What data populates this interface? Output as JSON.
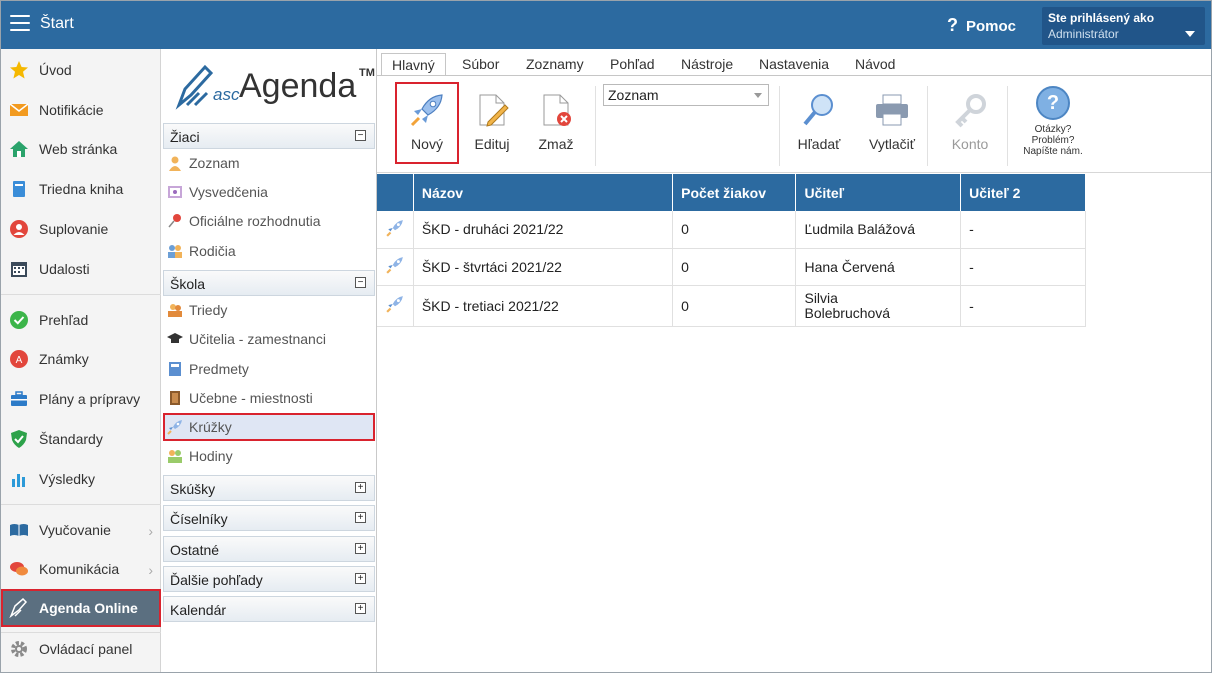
{
  "topbar": {
    "title": "Štart",
    "help": "Pomoc",
    "user_label": "Ste prihlásený ako",
    "user_role": "Administrátor"
  },
  "nav": {
    "items": [
      {
        "label": "Úvod",
        "icon": "star-icon"
      },
      {
        "label": "Notifikácie",
        "icon": "envelope-icon"
      },
      {
        "label": "Web stránka",
        "icon": "home-icon"
      },
      {
        "label": "Triedna kniha",
        "icon": "book-icon"
      },
      {
        "label": "Suplovanie",
        "icon": "person-icon"
      },
      {
        "label": "Udalosti",
        "icon": "calendar-icon"
      },
      {
        "label": "Prehľad",
        "icon": "check-icon"
      },
      {
        "label": "Známky",
        "icon": "grade-icon"
      },
      {
        "label": "Plány a prípravy",
        "icon": "briefcase-icon"
      },
      {
        "label": "Štandardy",
        "icon": "shield-icon"
      },
      {
        "label": "Výsledky",
        "icon": "bar-chart-icon"
      },
      {
        "label": "Vyučovanie",
        "icon": "open-book-icon"
      },
      {
        "label": "Komunikácia",
        "icon": "chat-icon"
      },
      {
        "label": "Agenda Online",
        "icon": "pen-icon"
      },
      {
        "label": "Ovládací panel",
        "icon": "gear-icon"
      }
    ]
  },
  "sub": {
    "logo_asc": "asc",
    "logo_agenda": "Agenda",
    "logo_tm": "TM",
    "zaci": "Žiaci",
    "zaci_items": [
      "Zoznam",
      "Vysvedčenia",
      "Oficiálne rozhodnutia",
      "Rodičia"
    ],
    "skola": "Škola",
    "skola_items": [
      "Triedy",
      "Učitelia - zamestnanci",
      "Predmety",
      "Učebne - miestnosti",
      "Krúžky",
      "Hodiny"
    ],
    "groups": [
      "Skúšky",
      "Číselníky",
      "Ostatné",
      "Ďalšie pohľady",
      "Kalendár"
    ],
    "minus": "−",
    "plus": "+"
  },
  "ribbon": {
    "tabs": [
      "Hlavný",
      "Súbor",
      "Zoznamy",
      "Pohľad",
      "Nástroje",
      "Nastavenia",
      "Návod"
    ],
    "new": "Nový",
    "edit": "Edituj",
    "delete": "Zmaž",
    "view_select": "Zoznam",
    "search": "Hľadať",
    "print": "Vytlačiť",
    "account": "Konto",
    "faq_q": "?",
    "faq": [
      "Otázky?",
      "Problém?",
      "Napíšte nám."
    ]
  },
  "table": {
    "headers": [
      "",
      "Názov",
      "Počet žiakov",
      "Učiteľ",
      "Učiteľ 2"
    ],
    "rows": [
      [
        "ŠKD - druháci 2021/22",
        "0",
        "Ľudmila Balážová",
        "-"
      ],
      [
        "ŠKD - štvrtáci 2021/22",
        "0",
        "Hana Červená",
        "-"
      ],
      [
        "ŠKD - tretiaci 2021/22",
        "0",
        "Silvia Bolebruchová",
        "-"
      ]
    ]
  },
  "colors": {
    "brand": "#2c6aa0",
    "highlight": "#d9232e"
  }
}
